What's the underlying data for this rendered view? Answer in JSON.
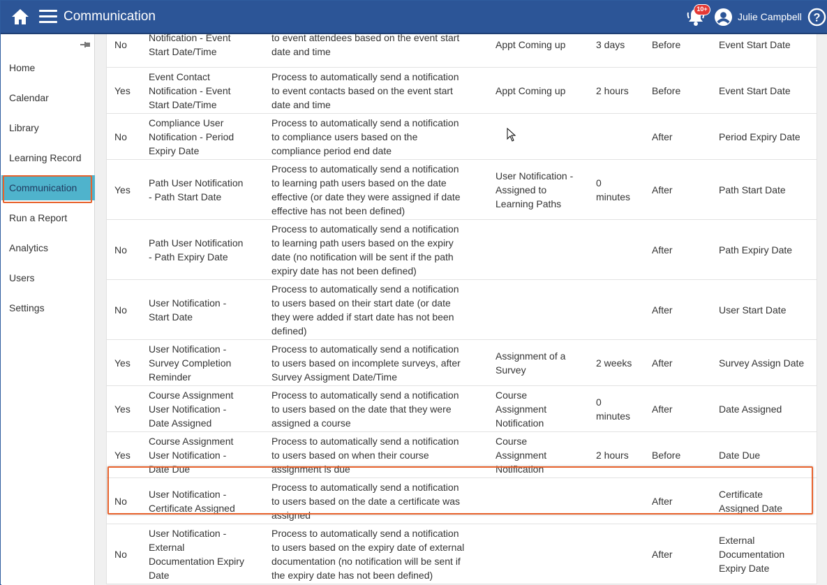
{
  "header": {
    "title": "Communication",
    "notification_badge": "10+",
    "user_name": "Julie Campbell"
  },
  "sidebar": {
    "items": [
      {
        "label": "Home"
      },
      {
        "label": "Calendar"
      },
      {
        "label": "Library"
      },
      {
        "label": "Learning Record"
      },
      {
        "label": "Communication",
        "active": true
      },
      {
        "label": "Run a Report"
      },
      {
        "label": "Analytics"
      },
      {
        "label": "Users"
      },
      {
        "label": "Settings"
      }
    ]
  },
  "table": {
    "rows": [
      {
        "active": "No",
        "name": [
          "Notification - Event",
          "Start Date/Time"
        ],
        "desc": [
          "to event attendees based on the event start",
          "date and time"
        ],
        "template": [
          "Appt Coming up"
        ],
        "timing": [
          "3 days"
        ],
        "when": "Before",
        "field": [
          "Event Start Date"
        ]
      },
      {
        "active": "Yes",
        "name": [
          "Event Contact",
          "Notification - Event",
          "Start Date/Time"
        ],
        "desc": [
          "Process to automatically send a notification",
          "to event contacts based on the event start",
          "date and time"
        ],
        "template": [
          "Appt Coming up"
        ],
        "timing": [
          "2 hours"
        ],
        "when": "Before",
        "field": [
          "Event Start Date"
        ]
      },
      {
        "active": "No",
        "name": [
          "Compliance User",
          "Notification - Period",
          "Expiry Date"
        ],
        "desc": [
          "Process to automatically send a notification",
          "to compliance users based on the",
          "compliance period end date"
        ],
        "template": [],
        "timing": [],
        "when": "After",
        "field": [
          "Period Expiry Date"
        ]
      },
      {
        "active": "Yes",
        "name": [
          "Path User Notification",
          "- Path Start Date"
        ],
        "desc": [
          "Process to automatically send a notification",
          "to learning path users based on the date",
          "effective (or date they were assigned if date",
          "effective has not been defined)"
        ],
        "template": [
          "User Notification -",
          "Assigned to",
          "Learning Paths"
        ],
        "timing": [
          "0",
          "minutes"
        ],
        "when": "After",
        "field": [
          "Path Start Date"
        ]
      },
      {
        "active": "No",
        "name": [
          "Path User Notification",
          "- Path Expiry Date"
        ],
        "desc": [
          "Process to automatically send a notification",
          "to learning path users based on the expiry",
          "date (no notification will be sent if the path",
          "expiry date has not been defined)"
        ],
        "template": [],
        "timing": [],
        "when": "After",
        "field": [
          "Path Expiry Date"
        ]
      },
      {
        "active": "No",
        "name": [
          "User Notification -",
          "Start Date"
        ],
        "desc": [
          "Process to automatically send a notification",
          "to users based on their start date (or date",
          "they were added if start date has not been",
          "defined)"
        ],
        "template": [],
        "timing": [],
        "when": "After",
        "field": [
          "User Start Date"
        ]
      },
      {
        "active": "Yes",
        "name": [
          "User Notification -",
          "Survey Completion",
          "Reminder"
        ],
        "desc": [
          "Process to automatically send a notification",
          "to users based on incomplete surveys, after",
          "Survey Assigment Date/Time"
        ],
        "template": [
          "Assignment of a",
          "Survey"
        ],
        "timing": [
          "2 weeks"
        ],
        "when": "After",
        "field": [
          "Survey Assign Date"
        ]
      },
      {
        "active": "Yes",
        "name": [
          "Course Assignment",
          "User Notification -",
          "Date Assigned"
        ],
        "desc": [
          "Process to automatically send a notification",
          "to users based on the date that they were",
          "assigned a course"
        ],
        "template": [
          "Course",
          "Assignment",
          "Notification"
        ],
        "timing": [
          "0",
          "minutes"
        ],
        "when": "After",
        "field": [
          "Date Assigned"
        ]
      },
      {
        "active": "Yes",
        "name": [
          "Course Assignment",
          "User Notification -",
          "Date Due"
        ],
        "desc": [
          "Process to automatically send a notification",
          "to users based on when their course",
          "assignment is due"
        ],
        "template": [
          "Course",
          "Assignment",
          "Notification"
        ],
        "timing": [
          "2 hours"
        ],
        "when": "Before",
        "field": [
          "Date Due"
        ]
      },
      {
        "active": "No",
        "name": [
          "User Notification -",
          "Certificate Assigned"
        ],
        "desc": [
          "Process to automatically send a notification",
          "to users based on the date a certificate was",
          "assigned"
        ],
        "template": [],
        "timing": [],
        "when": "After",
        "field": [
          "Certificate",
          "Assigned Date"
        ]
      },
      {
        "active": "No",
        "name": [
          "User Notification -",
          "External",
          "Documentation Expiry",
          "Date"
        ],
        "desc": [
          "Process to automatically send a notification",
          "to users based on the expiry date of external",
          "documentation (no notification will be sent if",
          "the expiry date has not been defined)"
        ],
        "template": [],
        "timing": [],
        "when": "After",
        "field": [
          "External",
          "Documentation",
          "Expiry Date"
        ]
      }
    ]
  },
  "colors": {
    "header_bg": "#2c5597",
    "active_nav_bg": "#4fb3cc",
    "highlight_border": "#e8622c",
    "badge_bg": "#e53935"
  },
  "icons": [
    "home-icon",
    "hamburger-menu-icon",
    "bell-icon",
    "user-avatar-icon",
    "help-icon",
    "pin-icon",
    "mouse-cursor-icon"
  ]
}
